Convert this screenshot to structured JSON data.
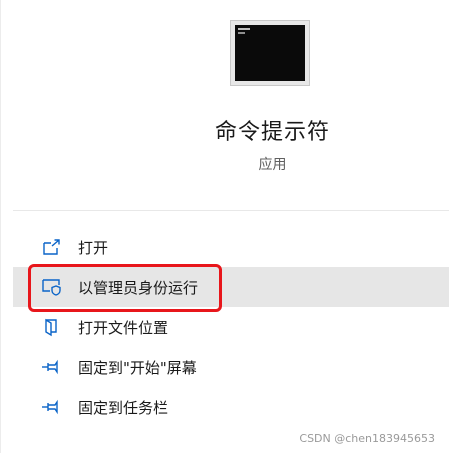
{
  "app": {
    "title": "命令提示符",
    "subtitle": "应用",
    "icon": "command-prompt-icon"
  },
  "menu": {
    "items": [
      {
        "label": "打开",
        "icon": "open-icon"
      },
      {
        "label": "以管理员身份运行",
        "icon": "shield-admin-icon",
        "highlighted": true
      },
      {
        "label": "打开文件位置",
        "icon": "file-location-icon"
      },
      {
        "label": "固定到\"开始\"屏幕",
        "icon": "pin-icon"
      },
      {
        "label": "固定到任务栏",
        "icon": "pin-icon"
      }
    ]
  },
  "watermark": "CSDN @chen183945653",
  "colors": {
    "accent": "#0a64c8",
    "highlight_bg": "#e6e6e6",
    "annotation_red": "#e8161b"
  }
}
